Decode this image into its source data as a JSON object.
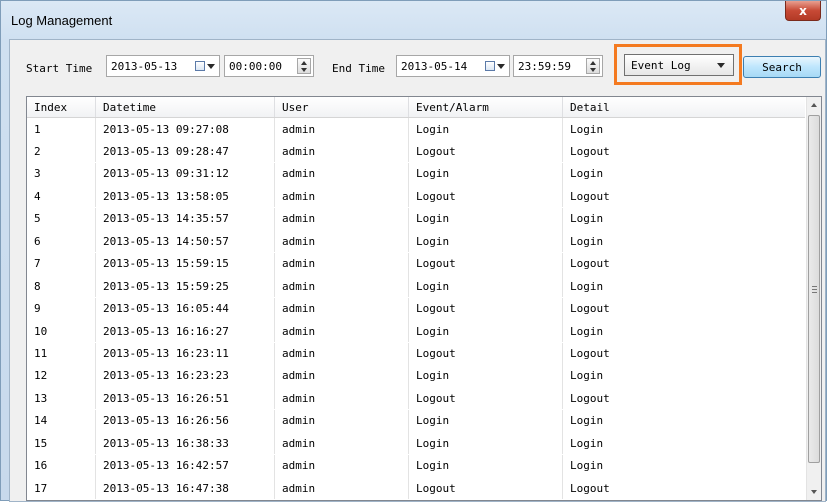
{
  "window": {
    "title": "Log Management",
    "close_symbol": "x"
  },
  "filters": {
    "start_label": "Start Time",
    "start_date": "2013-05-13",
    "start_time": "00:00:00",
    "end_label": "End Time",
    "end_date": "2013-05-14",
    "end_time": "23:59:59",
    "log_type": "Event Log",
    "search_label": "Search"
  },
  "colors": {
    "highlight": "#f47a20",
    "search_button": "#bee6fd"
  },
  "table": {
    "headers": [
      "Index",
      "Datetime",
      "User",
      "Event/Alarm",
      "Detail"
    ],
    "rows": [
      [
        "1",
        "2013-05-13 09:27:08",
        "admin",
        "Login",
        "Login"
      ],
      [
        "2",
        "2013-05-13 09:28:47",
        "admin",
        "Logout",
        "Logout"
      ],
      [
        "3",
        "2013-05-13 09:31:12",
        "admin",
        "Login",
        "Login"
      ],
      [
        "4",
        "2013-05-13 13:58:05",
        "admin",
        "Logout",
        "Logout"
      ],
      [
        "5",
        "2013-05-13 14:35:57",
        "admin",
        "Login",
        "Login"
      ],
      [
        "6",
        "2013-05-13 14:50:57",
        "admin",
        "Login",
        "Login"
      ],
      [
        "7",
        "2013-05-13 15:59:15",
        "admin",
        "Logout",
        "Logout"
      ],
      [
        "8",
        "2013-05-13 15:59:25",
        "admin",
        "Login",
        "Login"
      ],
      [
        "9",
        "2013-05-13 16:05:44",
        "admin",
        "Logout",
        "Logout"
      ],
      [
        "10",
        "2013-05-13 16:16:27",
        "admin",
        "Login",
        "Login"
      ],
      [
        "11",
        "2013-05-13 16:23:11",
        "admin",
        "Logout",
        "Logout"
      ],
      [
        "12",
        "2013-05-13 16:23:23",
        "admin",
        "Login",
        "Login"
      ],
      [
        "13",
        "2013-05-13 16:26:51",
        "admin",
        "Logout",
        "Logout"
      ],
      [
        "14",
        "2013-05-13 16:26:56",
        "admin",
        "Login",
        "Login"
      ],
      [
        "15",
        "2013-05-13 16:38:33",
        "admin",
        "Login",
        "Login"
      ],
      [
        "16",
        "2013-05-13 16:42:57",
        "admin",
        "Login",
        "Login"
      ],
      [
        "17",
        "2013-05-13 16:47:38",
        "admin",
        "Logout",
        "Logout"
      ]
    ]
  }
}
